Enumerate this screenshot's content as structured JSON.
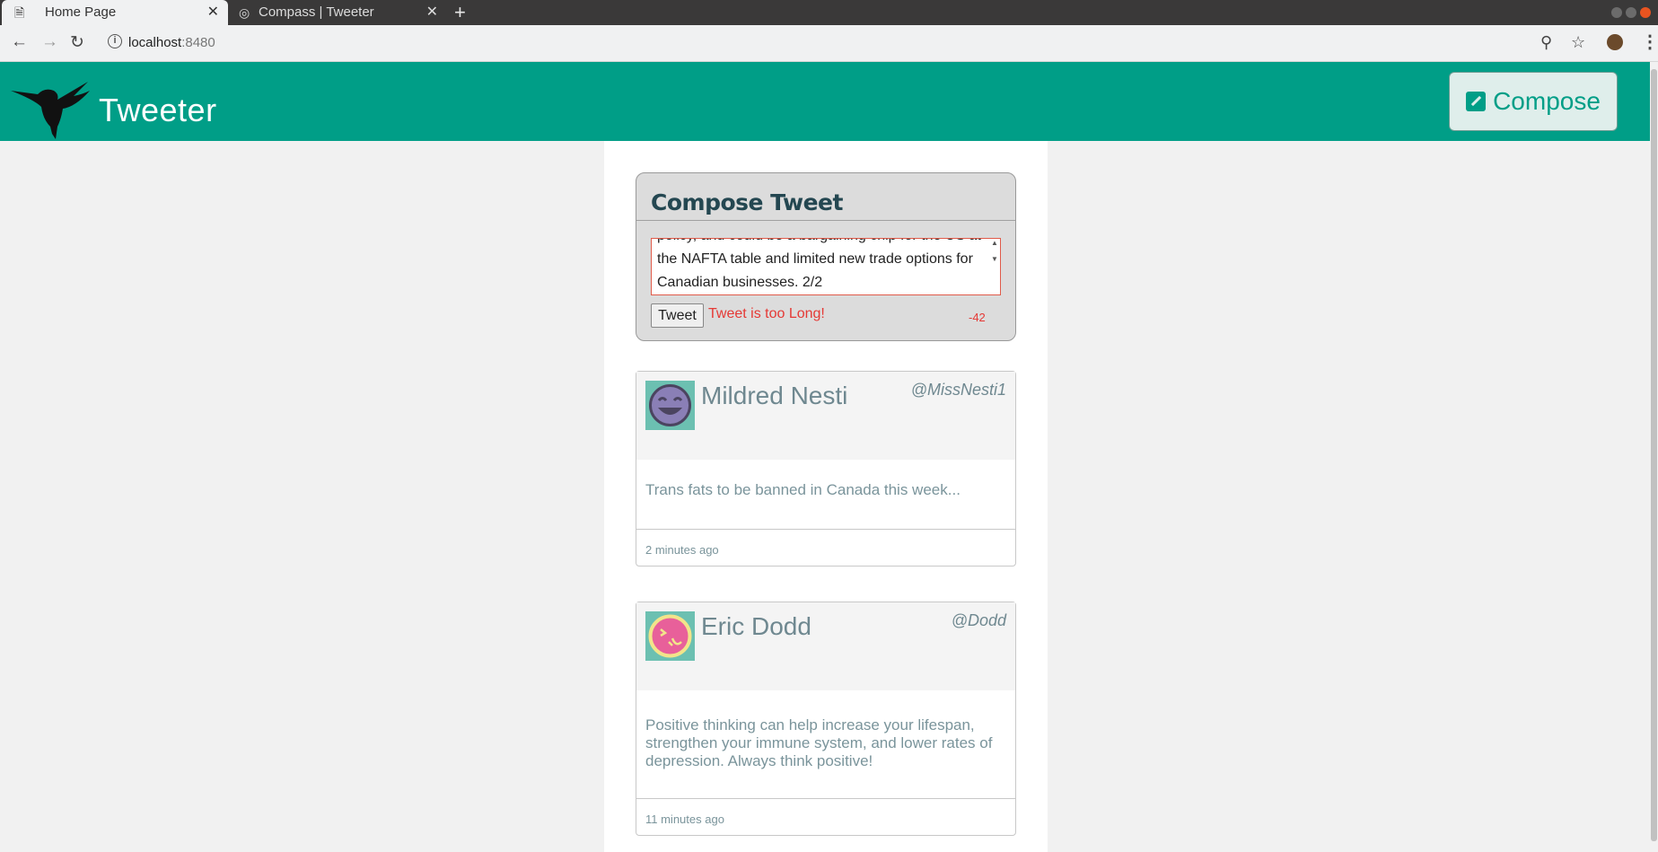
{
  "browser": {
    "tabs": [
      {
        "label": "Home Page",
        "active": true
      },
      {
        "label": "Compass | Tweeter",
        "active": false
      }
    ],
    "url_host": "localhost",
    "url_port": ":8480"
  },
  "header": {
    "brand": "Tweeter",
    "compose_label": "Compose"
  },
  "composer": {
    "title": "Compose Tweet",
    "text": "policy, and could be a bargaining chip for the US at the NAFTA table and limited new trade options for Canadian businesses. 2/2",
    "submit_label": "Tweet",
    "error": "Tweet is too Long!",
    "counter": "-42"
  },
  "tweets": [
    {
      "name": "Mildred Nesti",
      "handle": "@MissNesti1",
      "content": "Trans fats to be banned in Canada this week...",
      "time": "2 minutes ago"
    },
    {
      "name": "Eric Dodd",
      "handle": "@Dodd",
      "content": "Positive thinking can help increase your lifespan, strengthen your immune system, and lower rates of depression. Always think positive!",
      "time": "11 minutes ago"
    }
  ],
  "colors": {
    "header_bg": "#009e87",
    "error": "#e53935",
    "text_muted": "#7a949b"
  },
  "icons": [
    "file-icon",
    "globe-icon",
    "close-icon",
    "plus-icon",
    "back-icon",
    "forward-icon",
    "reload-icon",
    "info-icon",
    "zoom-icon",
    "star-icon",
    "menu-icon",
    "hummingbird-logo",
    "pencil-icon",
    "smiley-avatar-icon",
    "laughing-avatar-icon"
  ]
}
